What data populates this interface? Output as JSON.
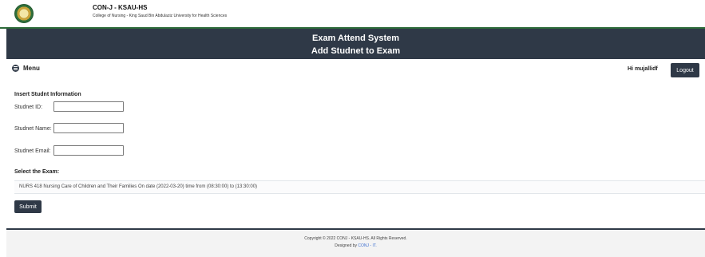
{
  "header": {
    "logo": "college-seal",
    "brand_title": "CON-J - KSAU-HS",
    "brand_subtitle": "College of Nursing - King Saud Bin Abdulaziz University for Health Sciences"
  },
  "banner": {
    "line1": "Exam Attend System",
    "line2": "Add Studnet to Exam"
  },
  "nav": {
    "menu_icon": "menu-icon",
    "menu_label": "Menu",
    "greeting": "Hi mujallidf",
    "logout_label": "Logout"
  },
  "form": {
    "section_title": "Insert Studnt Information",
    "student_id_label": "Studnet ID:",
    "student_id_value": "",
    "student_name_label": "Studnet Name:",
    "student_name_value": "",
    "student_email_label": "Studnet Email:",
    "student_email_value": "",
    "exam_select_label": "Select the Exam:",
    "exam_selected_option": "NURS 418 Nursing Care of Children and Their Families On date (2022-03-20) time from (08:30:00) to (13:30:00)",
    "submit_label": "Submit"
  },
  "footer": {
    "copyright": "Copyright © 2022 CONJ - KSAU-HS. All Rights Reserved.",
    "designed_by_prefix": "Designed by",
    "designed_by_link": "CONJ - IT."
  },
  "colors": {
    "banner_bg": "#2f3947",
    "accent_green": "#2e6b3a",
    "link_blue": "#3d6fd0"
  }
}
